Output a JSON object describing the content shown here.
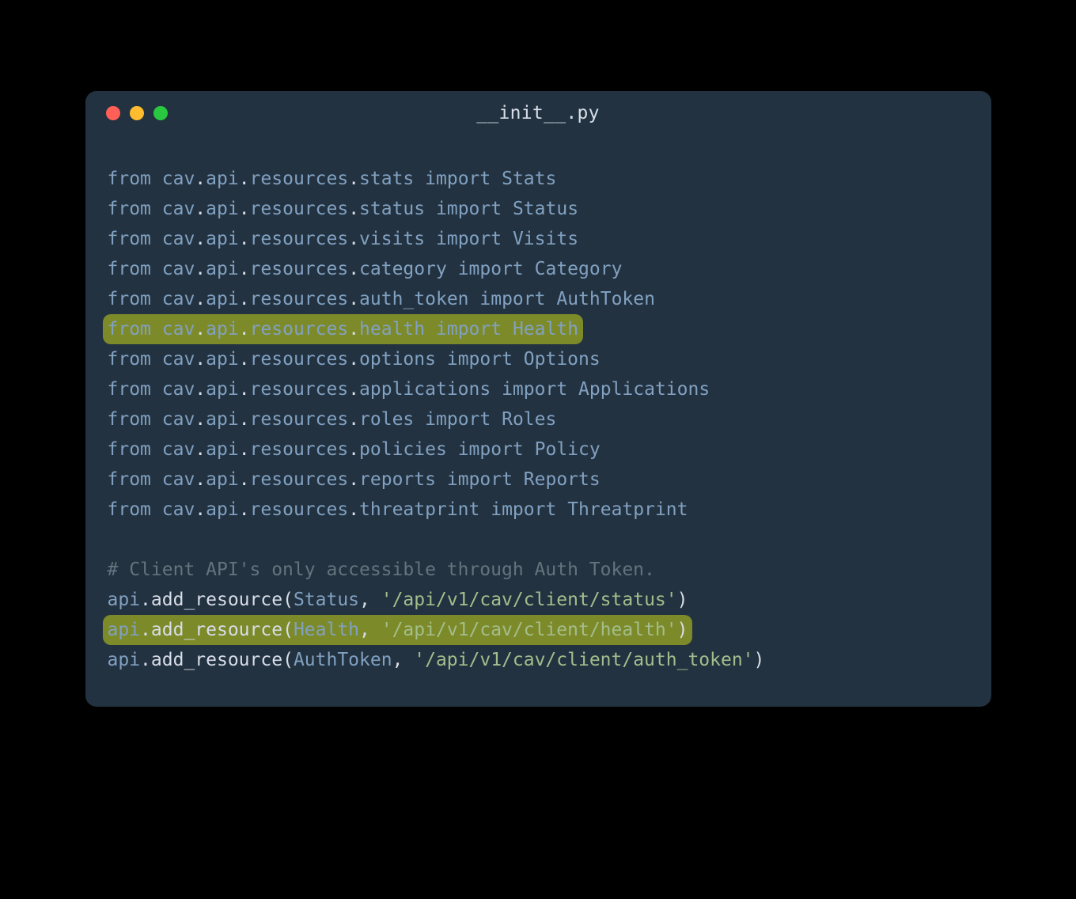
{
  "window": {
    "title": "__init__.py",
    "buttons": {
      "close": "red",
      "minimize": "yellow",
      "zoom": "green"
    }
  },
  "code": {
    "imports": [
      {
        "module": "cav.api.resources.stats",
        "name": "Stats",
        "highlight": false
      },
      {
        "module": "cav.api.resources.status",
        "name": "Status",
        "highlight": false
      },
      {
        "module": "cav.api.resources.visits",
        "name": "Visits",
        "highlight": false
      },
      {
        "module": "cav.api.resources.category",
        "name": "Category",
        "highlight": false
      },
      {
        "module": "cav.api.resources.auth_token",
        "name": "AuthToken",
        "highlight": false
      },
      {
        "module": "cav.api.resources.health",
        "name": "Health",
        "highlight": true
      },
      {
        "module": "cav.api.resources.options",
        "name": "Options",
        "highlight": false
      },
      {
        "module": "cav.api.resources.applications",
        "name": "Applications",
        "highlight": false
      },
      {
        "module": "cav.api.resources.roles",
        "name": "Roles",
        "highlight": false
      },
      {
        "module": "cav.api.resources.policies",
        "name": "Policy",
        "highlight": false
      },
      {
        "module": "cav.api.resources.reports",
        "name": "Reports",
        "highlight": false
      },
      {
        "module": "cav.api.resources.threatprint",
        "name": "Threatprint",
        "highlight": false
      }
    ],
    "comment": "# Client API's only accessible through Auth Token.",
    "calls": [
      {
        "cls": "Status",
        "path": "'/api/v1/cav/client/status'",
        "highlight": false
      },
      {
        "cls": "Health",
        "path": "'/api/v1/cav/client/health'",
        "highlight": true
      },
      {
        "cls": "AuthToken",
        "path": "'/api/v1/cav/client/auth_token'",
        "highlight": false
      }
    ]
  }
}
